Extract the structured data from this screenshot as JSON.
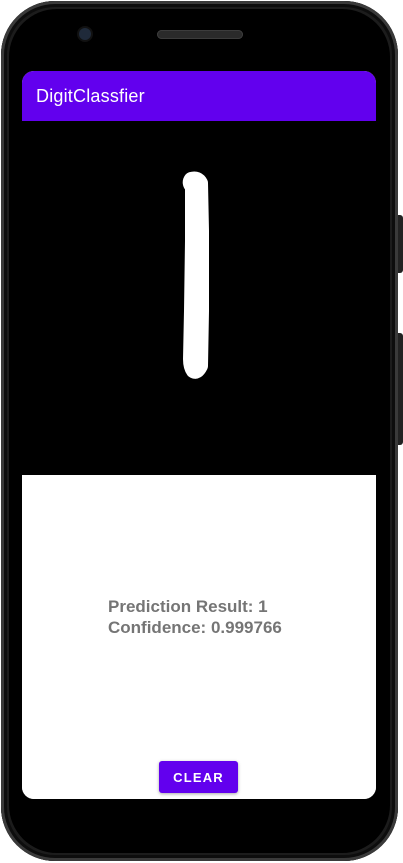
{
  "app_bar": {
    "title": "DigitClassfier",
    "color": "#6200ee"
  },
  "canvas": {
    "background": "#000000",
    "stroke_color": "#ffffff"
  },
  "result": {
    "prediction_line": "Prediction Result: 1",
    "confidence_line": "Confidence: 0.999766"
  },
  "actions": {
    "clear_label": "CLEAR"
  },
  "device": {
    "camera_icon": "front-camera-icon",
    "speaker_icon": "earpiece-speaker-icon"
  }
}
